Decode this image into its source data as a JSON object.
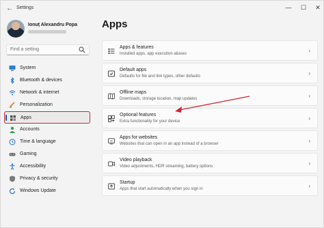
{
  "window": {
    "title": "Settings",
    "back_glyph": "←",
    "min_glyph": "—",
    "max_glyph": "☐",
    "close_glyph": "✕"
  },
  "profile": {
    "name": "Ionuț Alexandru Popa"
  },
  "search": {
    "placeholder": "Find a setting"
  },
  "nav": {
    "items": [
      {
        "label": "System",
        "icon": "monitor-icon"
      },
      {
        "label": "Bluetooth & devices",
        "icon": "bluetooth-icon"
      },
      {
        "label": "Network & internet",
        "icon": "wifi-icon"
      },
      {
        "label": "Personalization",
        "icon": "brush-icon"
      },
      {
        "label": "Apps",
        "icon": "apps-icon",
        "selected": true
      },
      {
        "label": "Accounts",
        "icon": "person-icon"
      },
      {
        "label": "Time & language",
        "icon": "globe-clock-icon"
      },
      {
        "label": "Gaming",
        "icon": "gamepad-icon"
      },
      {
        "label": "Accessibility",
        "icon": "accessibility-icon"
      },
      {
        "label": "Privacy & security",
        "icon": "shield-icon"
      },
      {
        "label": "Windows Update",
        "icon": "update-icon"
      }
    ]
  },
  "main": {
    "title": "Apps",
    "cards": [
      {
        "title": "Apps & features",
        "desc": "Installed apps, app execution aliases",
        "icon": "apps-list-icon"
      },
      {
        "title": "Default apps",
        "desc": "Defaults for file and link types, other defaults",
        "icon": "default-apps-icon"
      },
      {
        "title": "Offline maps",
        "desc": "Downloads, storage location, map updates",
        "icon": "map-icon"
      },
      {
        "title": "Optional features",
        "desc": "Extra functionality for your device",
        "icon": "optional-features-icon"
      },
      {
        "title": "Apps for websites",
        "desc": "Websites that can open in an app instead of a browser",
        "icon": "link-app-icon"
      },
      {
        "title": "Video playback",
        "desc": "Video adjustments, HDR streaming, battery options",
        "icon": "video-icon"
      },
      {
        "title": "Startup",
        "desc": "Apps that start automatically when you sign in",
        "icon": "startup-icon"
      }
    ],
    "chevron": "›"
  },
  "colors": {
    "accent": "#005fb8",
    "highlight_box": "#d0242e",
    "annotation_arrow": "#d0242e"
  }
}
